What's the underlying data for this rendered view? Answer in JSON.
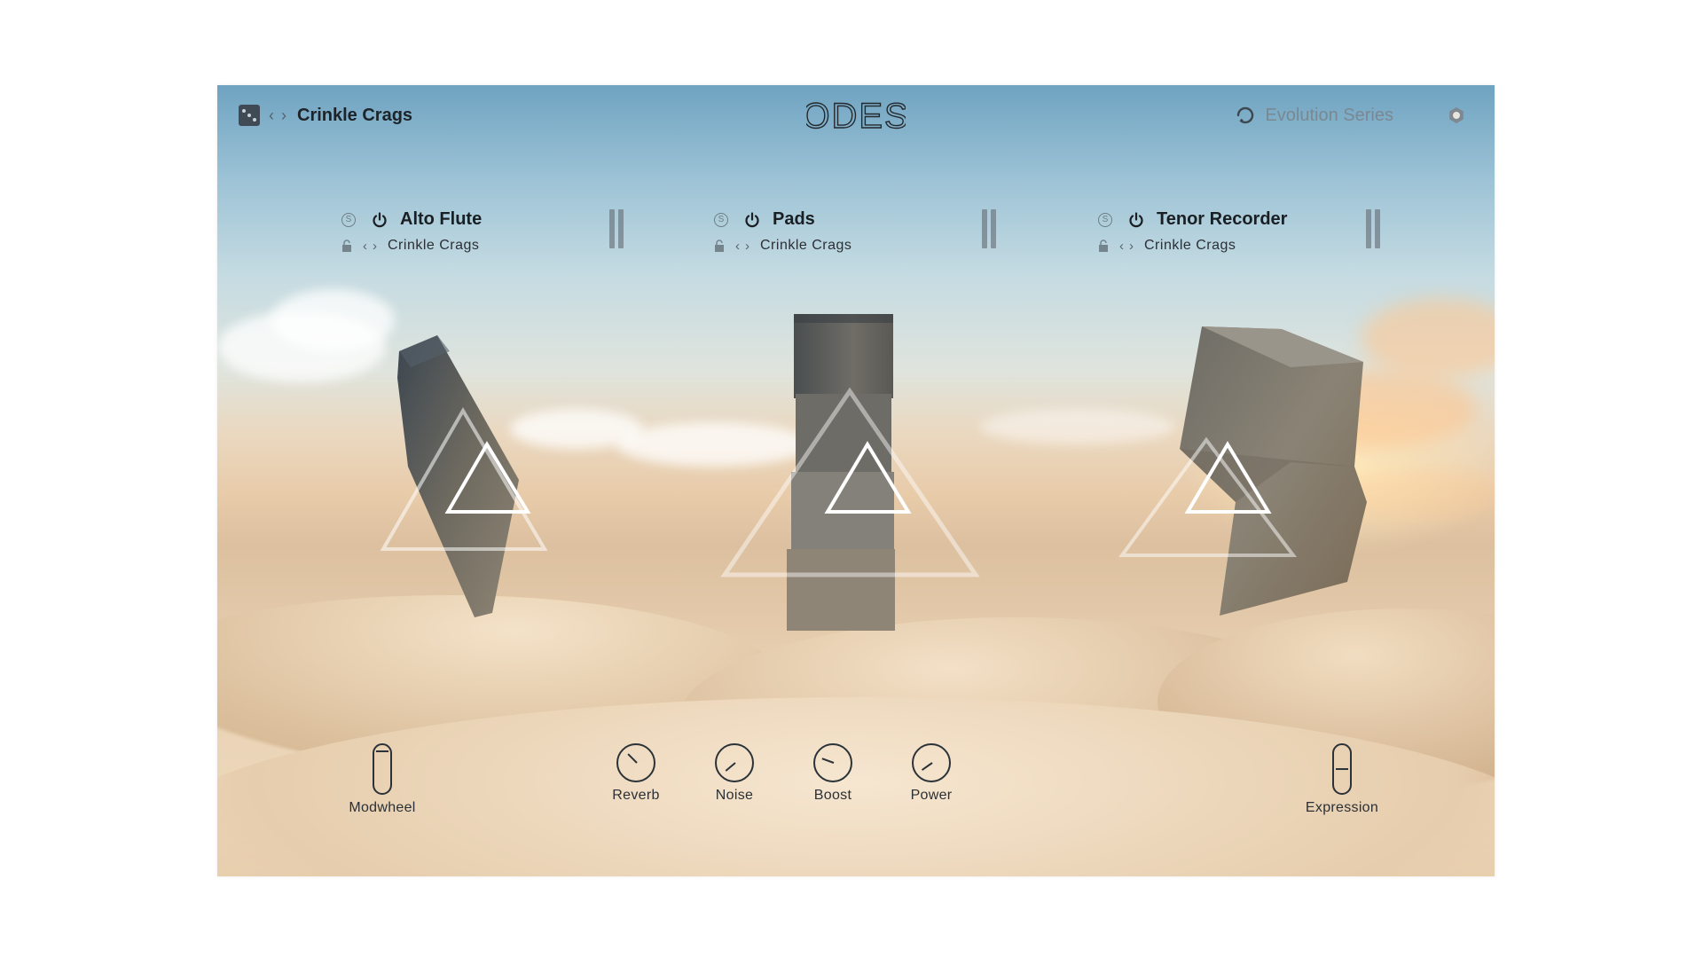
{
  "header": {
    "preset_name": "Crinkle Crags",
    "logo_text": "ODES",
    "series_label": "Evolution Series"
  },
  "instruments": [
    {
      "name": "Alto Flute",
      "preset": "Crinkle Crags",
      "solo_glyph": "S"
    },
    {
      "name": "Pads",
      "preset": "Crinkle Crags",
      "solo_glyph": "S"
    },
    {
      "name": "Tenor Recorder",
      "preset": "Crinkle Crags",
      "solo_glyph": "S"
    }
  ],
  "controls": {
    "modwheel": {
      "label": "Modwheel",
      "value": 1.0
    },
    "reverb": {
      "label": "Reverb"
    },
    "noise": {
      "label": "Noise"
    },
    "boost": {
      "label": "Boost"
    },
    "power": {
      "label": "Power"
    },
    "expression": {
      "label": "Expression",
      "value": 0.5
    }
  },
  "icons": {
    "randomize": "dice-icon",
    "prev": "chevron-left-icon",
    "next": "chevron-right-icon",
    "series": "evolution-ring-icon",
    "settings": "gear-icon",
    "solo": "solo-icon",
    "power": "power-icon",
    "lock": "lock-icon"
  },
  "colors": {
    "text_dark": "#1d2328",
    "text_muted": "#7a8891",
    "meter": "#6e7880"
  }
}
